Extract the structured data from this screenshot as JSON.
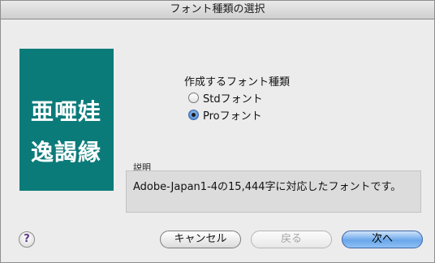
{
  "window": {
    "title": "フォント種類の選択"
  },
  "sample": {
    "line1": "亜唖娃",
    "line2": "逸謁縁"
  },
  "options": {
    "group_label": "作成するフォント種類",
    "items": [
      {
        "label": "Stdフォント",
        "selected": false
      },
      {
        "label": "Proフォント",
        "selected": true
      }
    ]
  },
  "description": {
    "label": "説明",
    "text": "Adobe-Japan1-4の15,444字に対応したフォントです。"
  },
  "buttons": {
    "help": "?",
    "cancel": "キャンセル",
    "back": "戻る",
    "next": "次へ"
  },
  "colors": {
    "sample_bg": "#0b7b7a",
    "default_button": "#6aa7ea"
  },
  "icons": {
    "help": "help-icon"
  }
}
